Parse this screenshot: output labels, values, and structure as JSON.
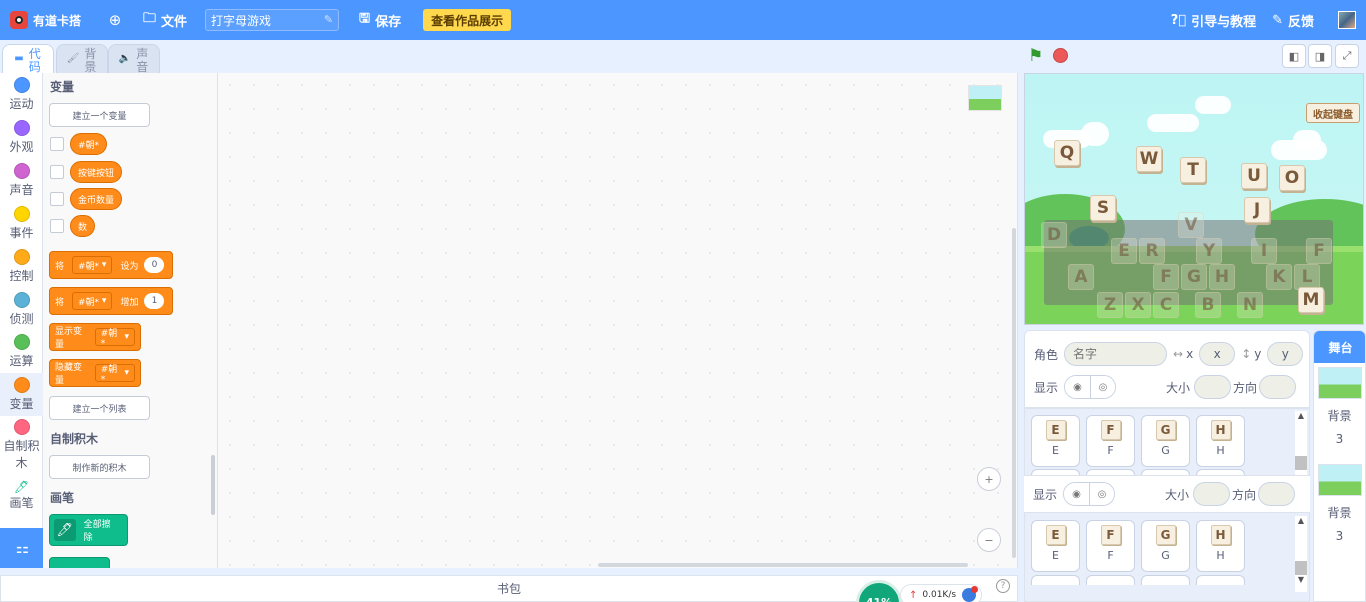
{
  "menu": {
    "brand": "有道卡搭",
    "file": "文件",
    "project_title": "打字母游戏",
    "save": "保存",
    "showcase": "查看作品展示",
    "guide": "引导与教程",
    "feedback": "反馈"
  },
  "tabs": [
    {
      "label": "代码"
    },
    {
      "label": "背景"
    },
    {
      "label": "声音"
    }
  ],
  "categories": [
    {
      "label": "运动",
      "color": "#4c97ff"
    },
    {
      "label": "外观",
      "color": "#9966ff"
    },
    {
      "label": "声音",
      "color": "#cf63cf"
    },
    {
      "label": "事件",
      "color": "#ffd500"
    },
    {
      "label": "控制",
      "color": "#ffab19"
    },
    {
      "label": "侦测",
      "color": "#5cb1d6"
    },
    {
      "label": "运算",
      "color": "#59c059"
    },
    {
      "label": "变量",
      "color": "#ff8c1a"
    },
    {
      "label": "自制积木",
      "color": "#ff6680"
    },
    {
      "label": "画笔",
      "color": "#0fbd8c"
    }
  ],
  "palette": {
    "variables_header": "变量",
    "make_variable": "建立一个变量",
    "variables": [
      "#朝*",
      "按键按钮",
      "金币数量",
      "数"
    ],
    "set_block": {
      "prefix": "将",
      "var": "#朝*",
      "verb": "设为",
      "value": "0"
    },
    "change_block": {
      "prefix": "将",
      "var": "#朝*",
      "verb": "增加",
      "value": "1"
    },
    "show_block": {
      "label": "显示变量",
      "var": "#朝*"
    },
    "hide_block": {
      "label": "隐藏变量",
      "var": "#朝*"
    },
    "make_list": "建立一个列表",
    "my_blocks_header": "自制积木",
    "make_block": "制作新的积木",
    "pen_header": "画笔",
    "erase_all": "全部擦除"
  },
  "workspace": {
    "zoom_in": "+",
    "zoom_out": "−"
  },
  "backpack": {
    "label": "书包"
  },
  "network": {
    "percent": "41%",
    "speed": "0.01K/s"
  },
  "stage": {
    "keyboard_toggle": "收起键盘",
    "keys_bright": [
      "Q",
      "W",
      "T",
      "U",
      "O",
      "S",
      "J"
    ],
    "keys_dim": [
      "V",
      "D",
      "E",
      "R",
      "Y",
      "I",
      "F",
      "A",
      "F",
      "G",
      "H",
      "K",
      "L",
      "Z",
      "X",
      "C",
      "B",
      "N",
      "M"
    ]
  },
  "sprite_info": {
    "sprite_label": "角色",
    "name_placeholder": "名字",
    "x_label": "x",
    "x_value": "x",
    "y_label": "y",
    "y_value": "y",
    "show_label": "显示",
    "size_label": "大小",
    "direction_label": "方向"
  },
  "sprites": [
    {
      "name": "E"
    },
    {
      "name": "F"
    },
    {
      "name": "G"
    },
    {
      "name": "H"
    }
  ],
  "stage_panel": {
    "header": "舞台",
    "backdrop_label": "背景",
    "backdrop_count": "3"
  },
  "colors": {
    "menu_bar": "#4c97ff",
    "showcase_button": "#ffd84d",
    "variables_orange": "#ff8c1a",
    "pen_green": "#0fbd8c"
  }
}
